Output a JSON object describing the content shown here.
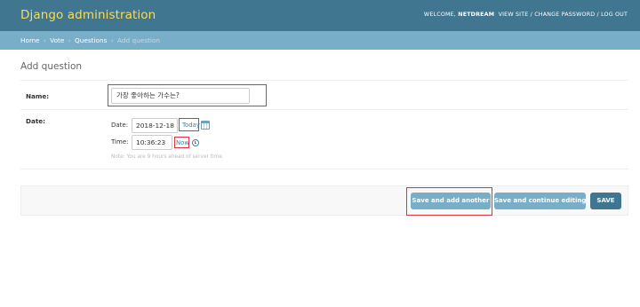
{
  "header": {
    "brand": "Django administration",
    "welcome": "WELCOME,",
    "username": "NETDREAM",
    "links": [
      "VIEW SITE",
      "CHANGE PASSWORD",
      "LOG OUT"
    ],
    "separator": " / "
  },
  "breadcrumbs": {
    "items": [
      "Home",
      "Vote",
      "Questions"
    ],
    "current": "Add question",
    "separator": "›"
  },
  "page": {
    "title": "Add question"
  },
  "form": {
    "name": {
      "label": "Name:",
      "value": "가장 좋아하는 가수는?"
    },
    "date": {
      "label": "Date:",
      "date_label": "Date:",
      "date_value": "2018-12-18",
      "today_link": "Today",
      "time_label": "Time:",
      "time_value": "10:36:23",
      "now_link": "Now",
      "help": "Note: You are 9 hours ahead of server time."
    }
  },
  "actions": {
    "save_add_another": "Save and add another",
    "save_continue": "Save and continue editing",
    "save": "SAVE"
  },
  "colors": {
    "header_bg": "#417690",
    "brand": "#f5dd5d",
    "breadcrumbs_bg": "#79aec8",
    "highlight": "#d9363e"
  },
  "icons": [
    "calendar-icon",
    "clock-icon"
  ]
}
